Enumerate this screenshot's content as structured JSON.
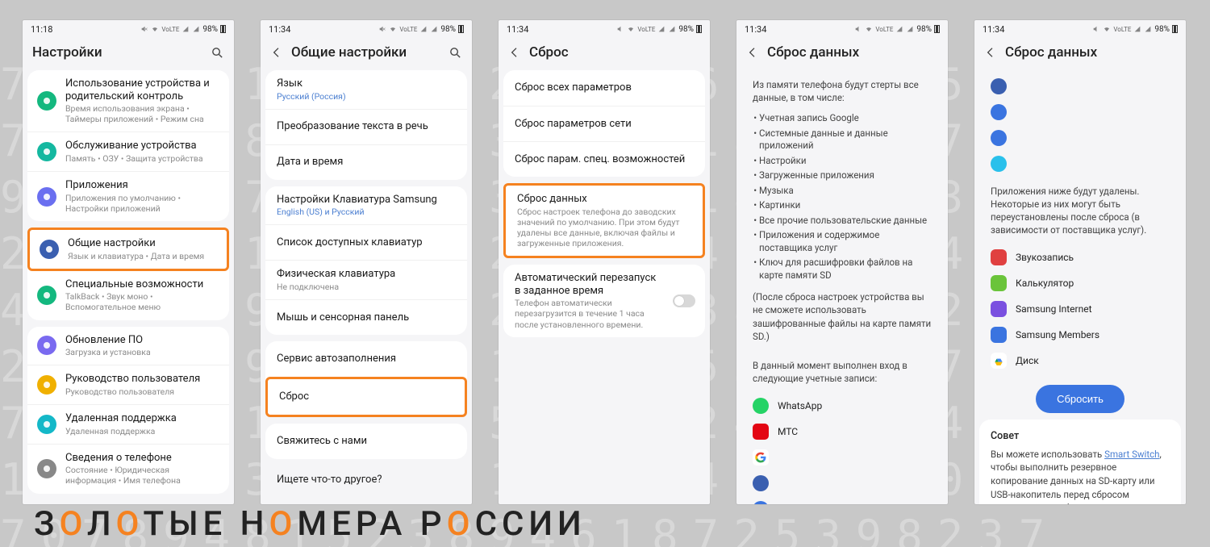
{
  "statusbar": {
    "time1": "11:18",
    "time2": "11:34",
    "battery": "98%"
  },
  "p1": {
    "title": "Настройки",
    "items": [
      {
        "title": "Использование устройства и родительский контроль",
        "sub": "Время использования экрана  •  Таймеры приложений  •  Режим сна",
        "color": "#14b87f"
      },
      {
        "title": "Обслуживание устройства",
        "sub": "Память  •  ОЗУ  •  Защита устройства",
        "color": "#14b8a0"
      },
      {
        "title": "Приложения",
        "sub": "Приложения по умолчанию  •  Настройки приложений",
        "color": "#6a6ff0"
      },
      {
        "title": "Общие настройки",
        "sub": "Язык и клавиатура  •  Дата и время",
        "color": "#3a5fb0",
        "hl": true
      },
      {
        "title": "Специальные возможности",
        "sub": "TalkBack  •  Звук моно  •  Вспомогательное меню",
        "color": "#14b87f"
      },
      {
        "title": "Обновление ПО",
        "sub": "Загрузка и установка",
        "color": "#7a6af0"
      },
      {
        "title": "Руководство пользователя",
        "sub": "Руководство пользователя",
        "color": "#f0b000"
      },
      {
        "title": "Удаленная поддержка",
        "sub": "Удаленная поддержка",
        "color": "#14b8c8"
      },
      {
        "title": "Сведения о телефоне",
        "sub": "Состояние  •  Юридическая информация  •  Имя телефона",
        "color": "#888"
      }
    ]
  },
  "p2": {
    "title": "Общие настройки",
    "g1": [
      {
        "title": "Язык",
        "sub": "Русский (Россия)",
        "sublink": true
      },
      {
        "title": "Преобразование текста в речь"
      },
      {
        "title": "Дата и время"
      }
    ],
    "g2": [
      {
        "title": "Настройки Клавиатура Samsung",
        "sub": "English (US) и Русский",
        "sublink": true
      },
      {
        "title": "Список доступных клавиатур"
      },
      {
        "title": "Физическая клавиатура",
        "sub": "Не подключена"
      },
      {
        "title": "Мышь и сенсорная панель"
      }
    ],
    "g3": [
      {
        "title": "Сервис автозаполнения"
      },
      {
        "title": "Сброс",
        "hl": true
      }
    ],
    "g4": [
      {
        "title": "Свяжитесь с нами"
      }
    ],
    "footer": "Ищете что-то другое?"
  },
  "p3": {
    "title": "Сброс",
    "g1": [
      {
        "title": "Сброс всех параметров"
      },
      {
        "title": "Сброс параметров сети"
      },
      {
        "title": "Сброс парам. спец. возможностей"
      }
    ],
    "g2": {
      "title": "Сброс данных",
      "sub": "Сброс настроек телефона до заводских значений по умолчанию. При этом будут удалены все данные, включая файлы и загруженные приложения.",
      "hl": true
    },
    "g3": {
      "title": "Автоматический перезапуск в заданное время",
      "sub": "Телефон автоматически перезагрузится в течение 1 часа после установленного времени."
    }
  },
  "p4": {
    "title": "Сброс данных",
    "intro": "Из памяти телефона будут стерты все данные, в том числе:",
    "bullets": [
      "Учетная запись Google",
      "Системные данные и данные приложений",
      "Настройки",
      "Загруженные приложения",
      "Музыка",
      "Картинки",
      "Все прочие пользовательские данные",
      "Приложения и содержимое поставщика услуг",
      "Ключ для расшифровки файлов на карте памяти SD"
    ],
    "note": "(После сброса настроек устройства вы не сможете использовать зашифрованные файлы на карте памяти SD.)",
    "accounts_intro": "В данный момент выполнен вход в следующие учетные записи:",
    "apps": [
      {
        "name": "WhatsApp",
        "color": "#25d366"
      },
      {
        "name": "МТС",
        "color": "#e30613"
      },
      {
        "name": "",
        "color": "#fff",
        "g": true
      },
      {
        "name": "",
        "color": "#3a5fb0"
      },
      {
        "name": "",
        "color": "#3a74e0"
      },
      {
        "name": "",
        "color": "#3a74e0"
      }
    ]
  },
  "p5": {
    "title": "Сброс данных",
    "top_icons": [
      "#3a5fb0",
      "#3a74e0",
      "#3a74e0",
      "#29c0eb"
    ],
    "apps_intro": "Приложения ниже будут удалены. Некоторые из них могут быть переустановлены после сброса (в зависимости от поставщика услуг).",
    "apps": [
      {
        "name": "Звукозапись",
        "color": "#e04040"
      },
      {
        "name": "Калькулятор",
        "color": "#6ac43a"
      },
      {
        "name": "Samsung Internet",
        "color": "#7a50e0"
      },
      {
        "name": "Samsung Members",
        "color": "#3a74e0"
      },
      {
        "name": "Диск",
        "color": "#fff",
        "drv": true
      }
    ],
    "button": "Сбросить",
    "advice_title": "Совет",
    "advice_text": "Вы можете использовать ",
    "advice_link": "Smart Switch",
    "advice_text2": ", чтобы выполнить резервное копирование данных на SD-карту или USB-накопитель перед сбросом параметров телефона."
  },
  "brand": "ЗОЛОТЫЕ НОМЕРА РОССИИ"
}
